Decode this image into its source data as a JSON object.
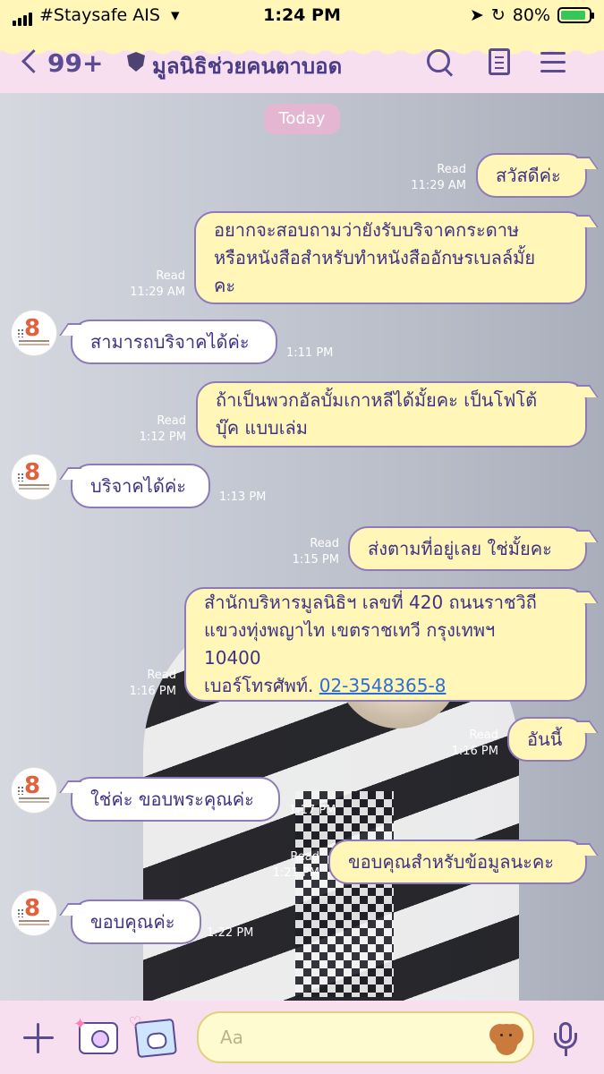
{
  "status_bar": {
    "carrier": "#Staysafe AIS",
    "time": "1:24 PM",
    "battery": "80%"
  },
  "header": {
    "back_count": "99+",
    "chat_title": "มูลนิธิช่วยคนตาบอด"
  },
  "date_label": "Today",
  "messages": [
    {
      "side": "out",
      "text": "สวัสดีค่ะ",
      "status": "Read",
      "time": "11:29 AM"
    },
    {
      "side": "out",
      "text": "อยากจะสอบถามว่ายังรับบริจาคกระดาษ\nหรือหนังสือสำหรับทำหนังสืออักษรเบลล์มั้ย\nคะ",
      "status": "Read",
      "time": "11:29 AM"
    },
    {
      "side": "in",
      "text": "สามารถบริจาคได้ค่ะ",
      "time": "1:11 PM"
    },
    {
      "side": "out",
      "text": "ถ้าเป็นพวกอัลบั้มเกาหลีได้มั้ยคะ เป็นโฟโต้\nบุ๊ค แบบเล่ม",
      "status": "Read",
      "time": "1:12 PM"
    },
    {
      "side": "in",
      "text": "บริจาคได้ค่ะ",
      "time": "1:13 PM"
    },
    {
      "side": "out",
      "text": "ส่งตามที่อยู่เลย ใช่มั้ยคะ",
      "status": "Read",
      "time": "1:15 PM"
    },
    {
      "side": "out",
      "text": "สำนักบริหารมูลนิธิฯ เลขที่ 420 ถนนราชวิถี\nแขวงทุ่งพญาไท เขตราชเทวี กรุงเทพฯ\n10400",
      "phone_label": "เบอร์โทรศัพท์. ",
      "phone": "02-3548365-8",
      "status": "Read",
      "time": "1:16 PM"
    },
    {
      "side": "out",
      "text": "อันนี้",
      "status": "Read",
      "time": "1:16 PM"
    },
    {
      "side": "in",
      "text": "ใช่ค่ะ ขอบพระคุณค่ะ",
      "time": "1:17 PM"
    },
    {
      "side": "out",
      "text": "ขอบคุณสำหรับข้อมูลนะคะ",
      "status": "Read",
      "time": "1:21 PM"
    },
    {
      "side": "in",
      "text": "ขอบคุณค่ะ",
      "time": "1:22 PM"
    }
  ],
  "input": {
    "placeholder": "Aa"
  },
  "icons": {
    "back": "chevron-left-icon",
    "official": "shield-icon",
    "search": "search-icon",
    "notes": "note-icon",
    "menu": "menu-icon",
    "add": "plus-icon",
    "camera": "camera-icon",
    "photo": "photo-icon",
    "sticker": "sticker-icon",
    "mic": "mic-icon"
  },
  "colors": {
    "outgoing_bubble": "#fff6b8",
    "incoming_bubble": "#ffffff",
    "bubble_border": "#8d7bb8",
    "text": "#3f3384",
    "header_pink": "#f8dff0",
    "link": "#2c6ed6"
  }
}
